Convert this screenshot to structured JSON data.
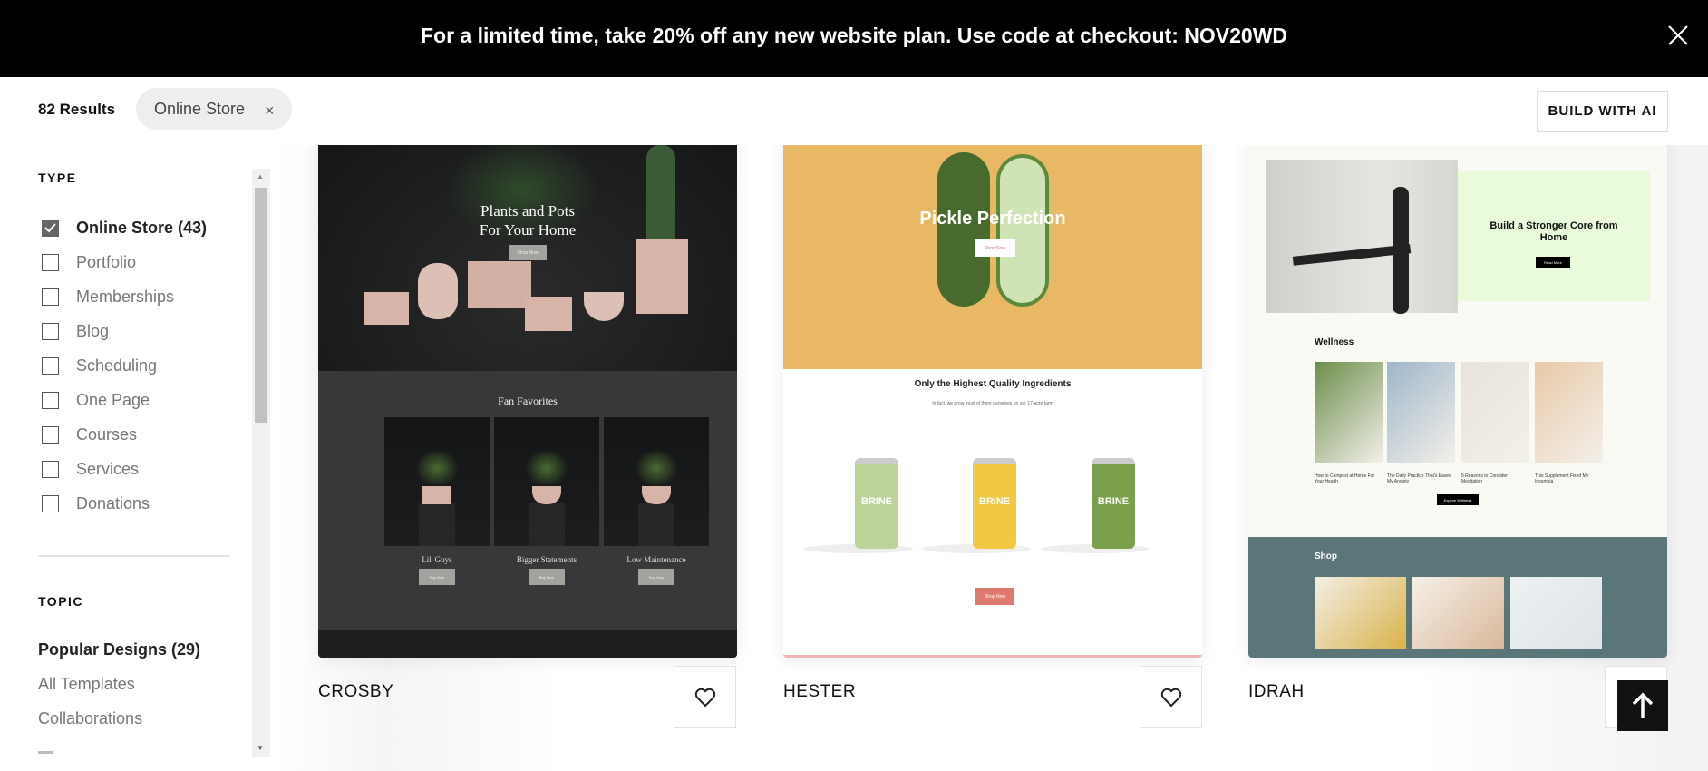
{
  "banner": {
    "message": "For a limited time, take 20% off any new website plan. Use code at checkout: NOV20WD",
    "close_icon": "close-icon"
  },
  "header": {
    "results": "82 Results",
    "filter_chip": "Online Store",
    "chip_remove": "×",
    "build_ai": "BUILD WITH AI"
  },
  "sidebar": {
    "type_heading": "TYPE",
    "types": [
      {
        "label": "Online Store (43)",
        "checked": true
      },
      {
        "label": "Portfolio",
        "checked": false
      },
      {
        "label": "Memberships",
        "checked": false
      },
      {
        "label": "Blog",
        "checked": false
      },
      {
        "label": "Scheduling",
        "checked": false
      },
      {
        "label": "One Page",
        "checked": false
      },
      {
        "label": "Courses",
        "checked": false
      },
      {
        "label": "Services",
        "checked": false
      },
      {
        "label": "Donations",
        "checked": false
      }
    ],
    "topic_heading": "TOPIC",
    "topics": [
      {
        "label": "Popular Designs (29)",
        "selected": true
      },
      {
        "label": "All Templates"
      },
      {
        "label": "Collaborations"
      }
    ]
  },
  "templates": [
    {
      "name": "CROSBY",
      "preview": {
        "hero": "Plants and Pots",
        "hero2": "For Your Home",
        "cta": "Shop Now",
        "section": "Fan Favorites",
        "products": [
          "Lil' Guys",
          "Bigger Statements",
          "Low Maintenance"
        ],
        "buy": "Buy Now"
      }
    },
    {
      "name": "HESTER",
      "preview": {
        "hero": "Pickle Perfection",
        "cta": "Shop Now",
        "heading": "Only the Highest Quality Ingredients",
        "sub": "In fact, we grow most of them ourselves on our 17-acre farm",
        "jar": "BRINE",
        "cta2": "Shop Now"
      }
    },
    {
      "name": "IDRAH",
      "preview": {
        "hero": "Build a Stronger Core from Home",
        "cta": "Read More",
        "section": "Wellness",
        "articles": [
          "How to Compost at Home For Your Health",
          "The Daily Practice That's Eases My Anxiety",
          "5 Reasons to Consider Meditation",
          "This Supplement Fixed My Insomnia"
        ],
        "cta2": "Explore Wellness",
        "shop": "Shop"
      }
    }
  ],
  "colors": {
    "banner": "#000000",
    "hester_yellow": "#e8b865",
    "idrah_teal": "#5b7679",
    "idrah_green": "#eafbdc",
    "crosby_dark": "#1b1c1e"
  }
}
